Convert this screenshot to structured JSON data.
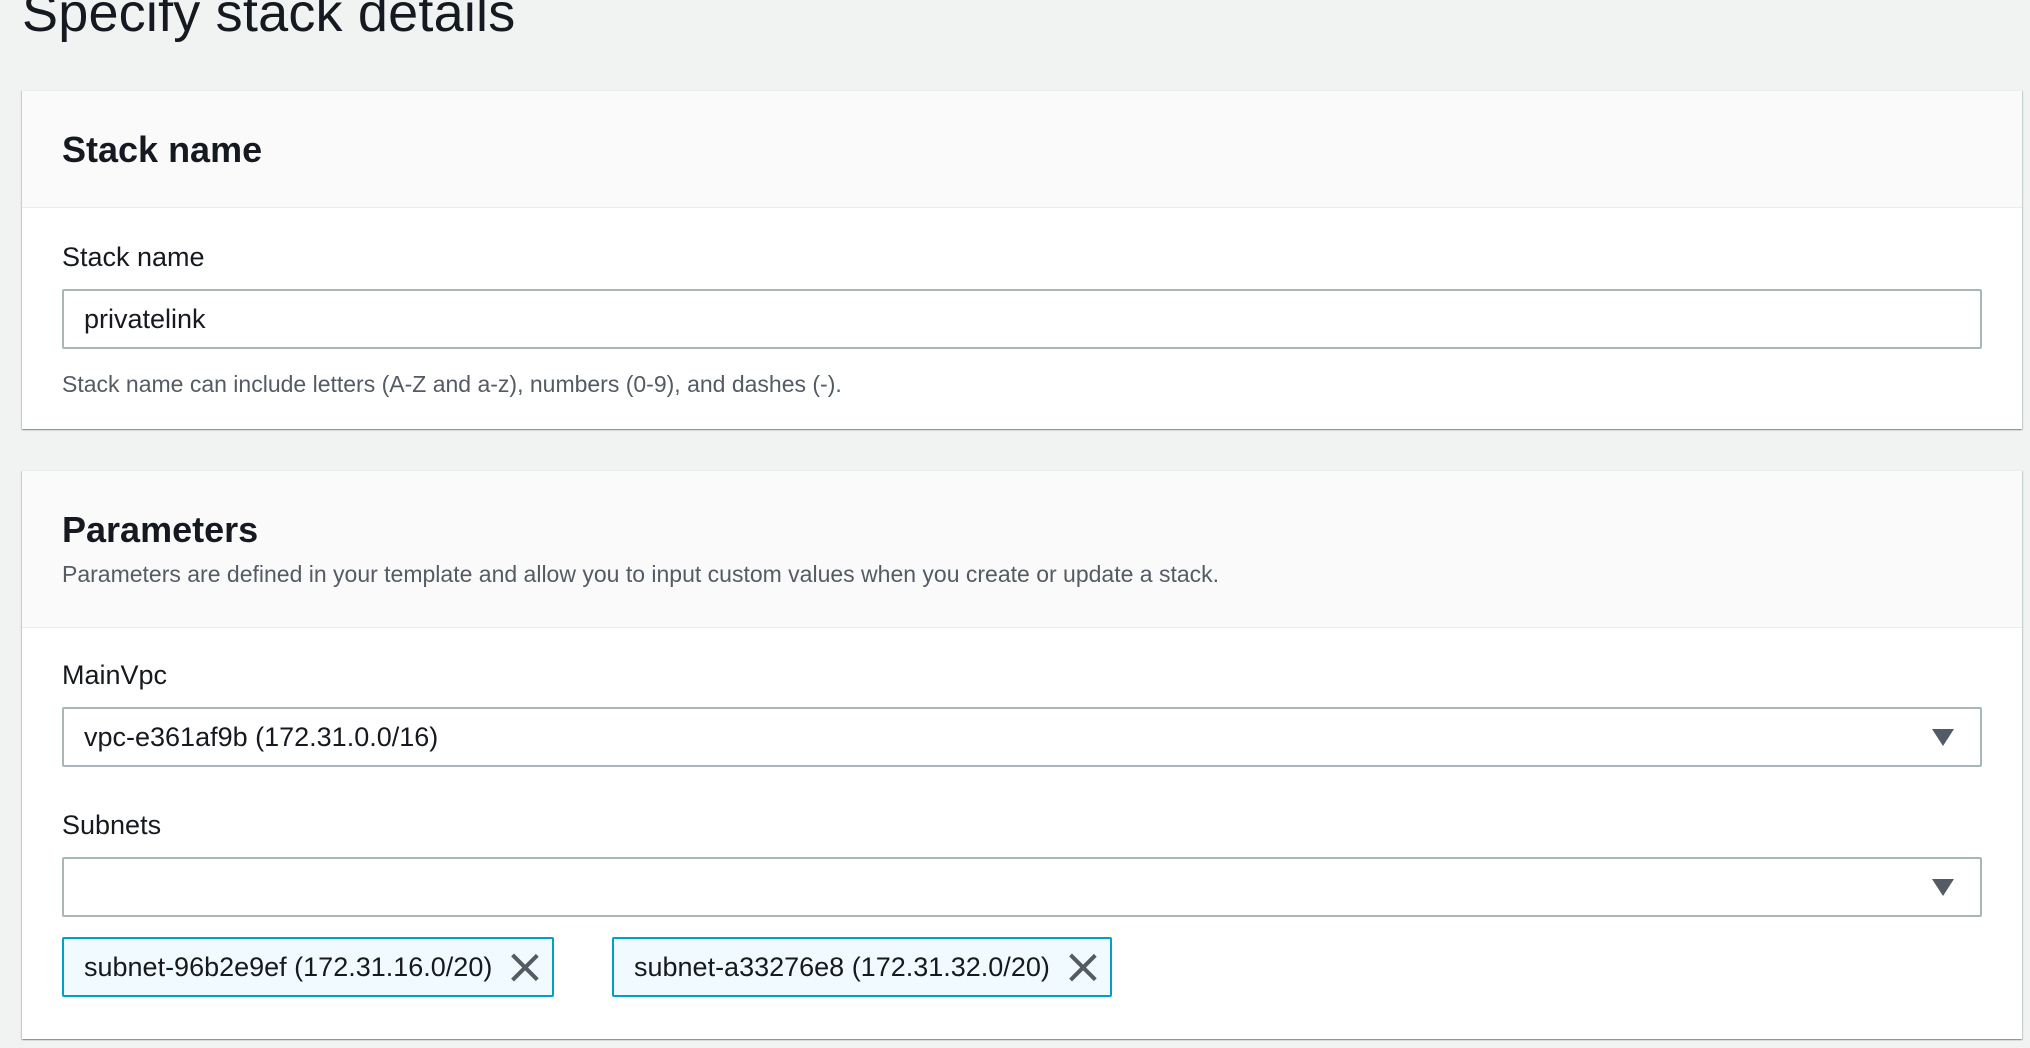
{
  "page": {
    "title": "Specify stack details"
  },
  "stack_name_section": {
    "header": "Stack name",
    "field_label": "Stack name",
    "input_value": "privatelink",
    "constraint": "Stack name can include letters (A-Z and a-z), numbers (0-9), and dashes (-)."
  },
  "parameters_section": {
    "header": "Parameters",
    "description": "Parameters are defined in your template and allow you to input custom values when you create or update a stack.",
    "main_vpc": {
      "label": "MainVpc",
      "selected": "vpc-e361af9b (172.31.0.0/16)"
    },
    "subnets": {
      "label": "Subnets",
      "selected": "",
      "tokens": [
        "subnet-96b2e9ef (172.31.16.0/20)",
        "subnet-a33276e8 (172.31.32.0/20)"
      ]
    }
  },
  "icons": {
    "dropdown": "caret-down-icon",
    "dismiss": "close-icon"
  },
  "colors": {
    "token_border": "#00a1c9",
    "token_background": "#f1faff",
    "page_background": "#f1f3f3"
  }
}
